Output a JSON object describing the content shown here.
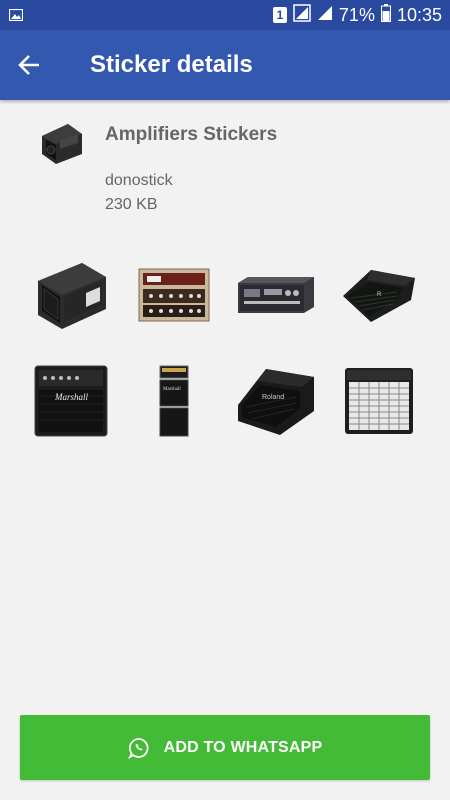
{
  "status_bar": {
    "sim_slot": "1",
    "battery": "71%",
    "time": "10:35"
  },
  "app_bar": {
    "title": "Sticker details"
  },
  "pack": {
    "name": "Amplifiers Stickers",
    "publisher": "donostick",
    "size": "230 KB"
  },
  "stickers": [
    {
      "kind": "combo-amp-angled"
    },
    {
      "kind": "tube-head-vintage"
    },
    {
      "kind": "rack-amplifier"
    },
    {
      "kind": "monitor-wedge"
    },
    {
      "kind": "marshall-combo"
    },
    {
      "kind": "mini-stack"
    },
    {
      "kind": "wedge-amp-large"
    },
    {
      "kind": "grille-combo"
    }
  ],
  "actions": {
    "add_label": "ADD TO WHATSAPP"
  },
  "colors": {
    "status_bar": "#2a4aa0",
    "app_bar": "#3358b0",
    "button": "#43bb36",
    "background": "#f2f2f2"
  }
}
